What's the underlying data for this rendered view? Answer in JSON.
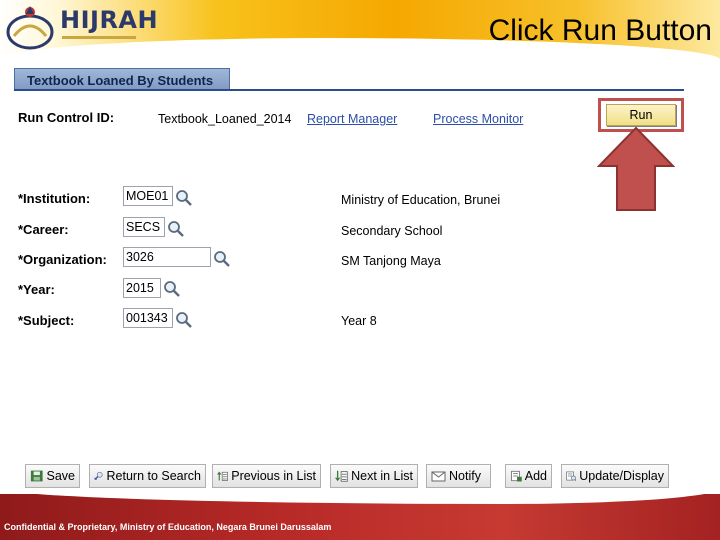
{
  "slide": {
    "title": "Click Run Button"
  },
  "logo": {
    "text": "HIJRAH"
  },
  "tab": {
    "label": "Textbook Loaned By Students"
  },
  "run_control": {
    "label": "Run Control ID:",
    "value": "Textbook_Loaned_2014",
    "report_manager": "Report Manager",
    "process_monitor": "Process Monitor",
    "run_label": "Run"
  },
  "fields": {
    "institution": {
      "label": "*Institution:",
      "value": "MOE01",
      "desc": "Ministry of Education, Brunei"
    },
    "career": {
      "label": "*Career:",
      "value": "SECS",
      "desc": "Secondary School"
    },
    "organization": {
      "label": "*Organization:",
      "value": "3026",
      "desc": "SM Tanjong Maya"
    },
    "year": {
      "label": "*Year:",
      "value": "2015"
    },
    "subject": {
      "label": "*Subject:",
      "value": "001343",
      "desc": "Year 8"
    }
  },
  "toolbar": {
    "save": "Save",
    "return_to_search": "Return to Search",
    "previous_in_list": "Previous in List",
    "next_in_list": "Next in List",
    "notify": "Notify",
    "add": "Add",
    "update_display": "Update/Display"
  },
  "footer": {
    "text": "Confidential & Proprietary, Ministry of Education, Negara Brunei Darussalam"
  },
  "colors": {
    "highlight": "#c0504d",
    "link": "#2b4fa6",
    "tab": "#7f99c2",
    "footer": "#b82a28"
  }
}
